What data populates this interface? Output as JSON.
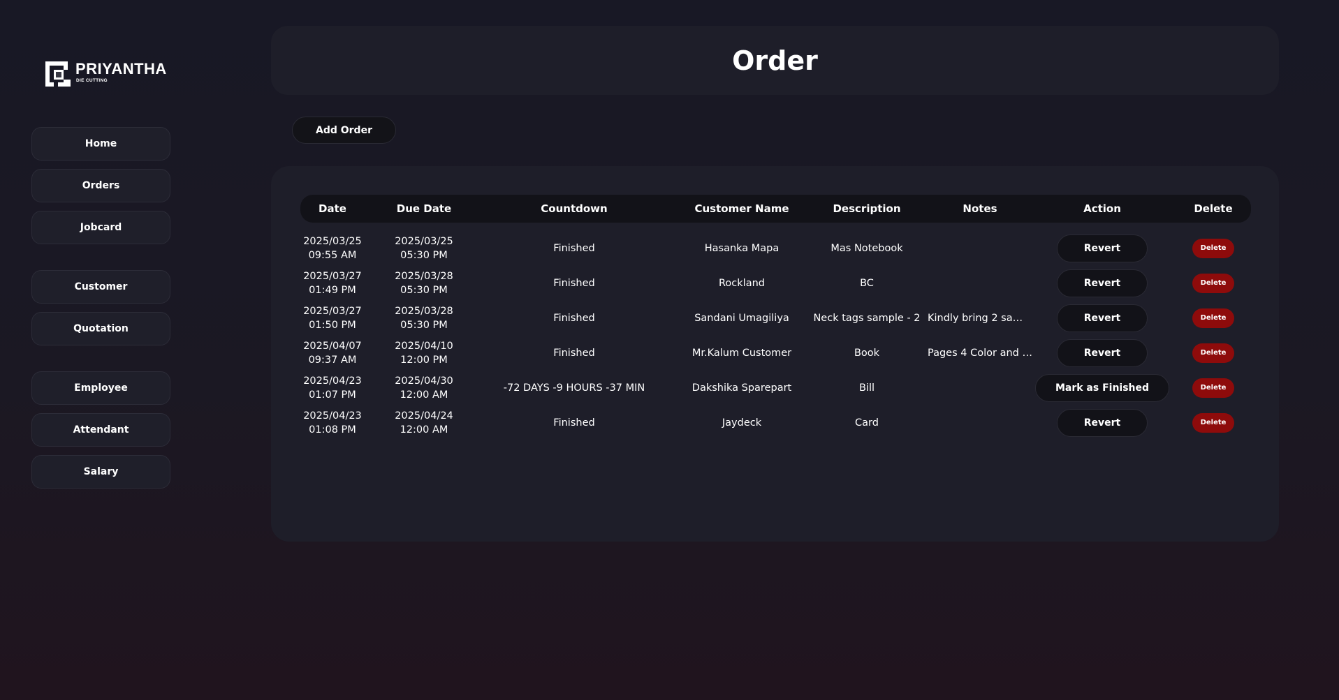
{
  "brand": {
    "name": "PRIYANTHA",
    "tagline": "DIE CUTTING"
  },
  "sidebar": {
    "items": [
      {
        "label": "Home"
      },
      {
        "label": "Orders"
      },
      {
        "label": "Jobcard"
      },
      {
        "label": "Customer"
      },
      {
        "label": "Quotation"
      },
      {
        "label": "Employee"
      },
      {
        "label": "Attendant"
      },
      {
        "label": "Salary"
      }
    ]
  },
  "header": {
    "title": "Order"
  },
  "toolbar": {
    "add_order_label": "Add Order"
  },
  "table": {
    "columns": [
      "Date",
      "Due Date",
      "Countdown",
      "Customer Name",
      "Description",
      "Notes",
      "Action",
      "Delete"
    ],
    "rows": [
      {
        "date": "2025/03/25",
        "date_time": "09:55 AM",
        "due": "2025/03/25",
        "due_time": "05:30 PM",
        "countdown": "Finished",
        "customer": "Hasanka Mapa",
        "description": "Mas Notebook",
        "notes": "",
        "action": "Revert",
        "delete": "Delete"
      },
      {
        "date": "2025/03/27",
        "date_time": "01:49 PM",
        "due": "2025/03/28",
        "due_time": "05:30 PM",
        "countdown": "Finished",
        "customer": "Rockland",
        "description": "BC",
        "notes": "",
        "action": "Revert",
        "delete": "Delete"
      },
      {
        "date": "2025/03/27",
        "date_time": "01:50 PM",
        "due": "2025/03/28",
        "due_time": "05:30 PM",
        "countdown": "Finished",
        "customer": "Sandani Umagiliya",
        "description": "Neck tags sample - 2",
        "notes": "Kindly bring 2 sampl...",
        "action": "Revert",
        "delete": "Delete"
      },
      {
        "date": "2025/04/07",
        "date_time": "09:37 AM",
        "due": "2025/04/10",
        "due_time": "12:00 PM",
        "countdown": "Finished",
        "customer": "Mr.Kalum Customer",
        "description": "Book",
        "notes": "Pages 4 Color and P...",
        "action": "Revert",
        "delete": "Delete"
      },
      {
        "date": "2025/04/23",
        "date_time": "01:07 PM",
        "due": "2025/04/30",
        "due_time": "12:00 AM",
        "countdown": "-72 DAYS -9 HOURS -37 MIN",
        "customer": "Dakshika Sparepart",
        "description": "Bill",
        "notes": "",
        "action": "Mark as Finished",
        "delete": "Delete"
      },
      {
        "date": "2025/04/23",
        "date_time": "01:08 PM",
        "due": "2025/04/24",
        "due_time": "12:00 AM",
        "countdown": "Finished",
        "customer": "Jaydeck",
        "description": "Card",
        "notes": "",
        "action": "Revert",
        "delete": "Delete"
      }
    ]
  },
  "colors": {
    "background": "#181825",
    "card": "#1e1e29",
    "table_header": "#121218",
    "delete": "#8e0b0b"
  }
}
